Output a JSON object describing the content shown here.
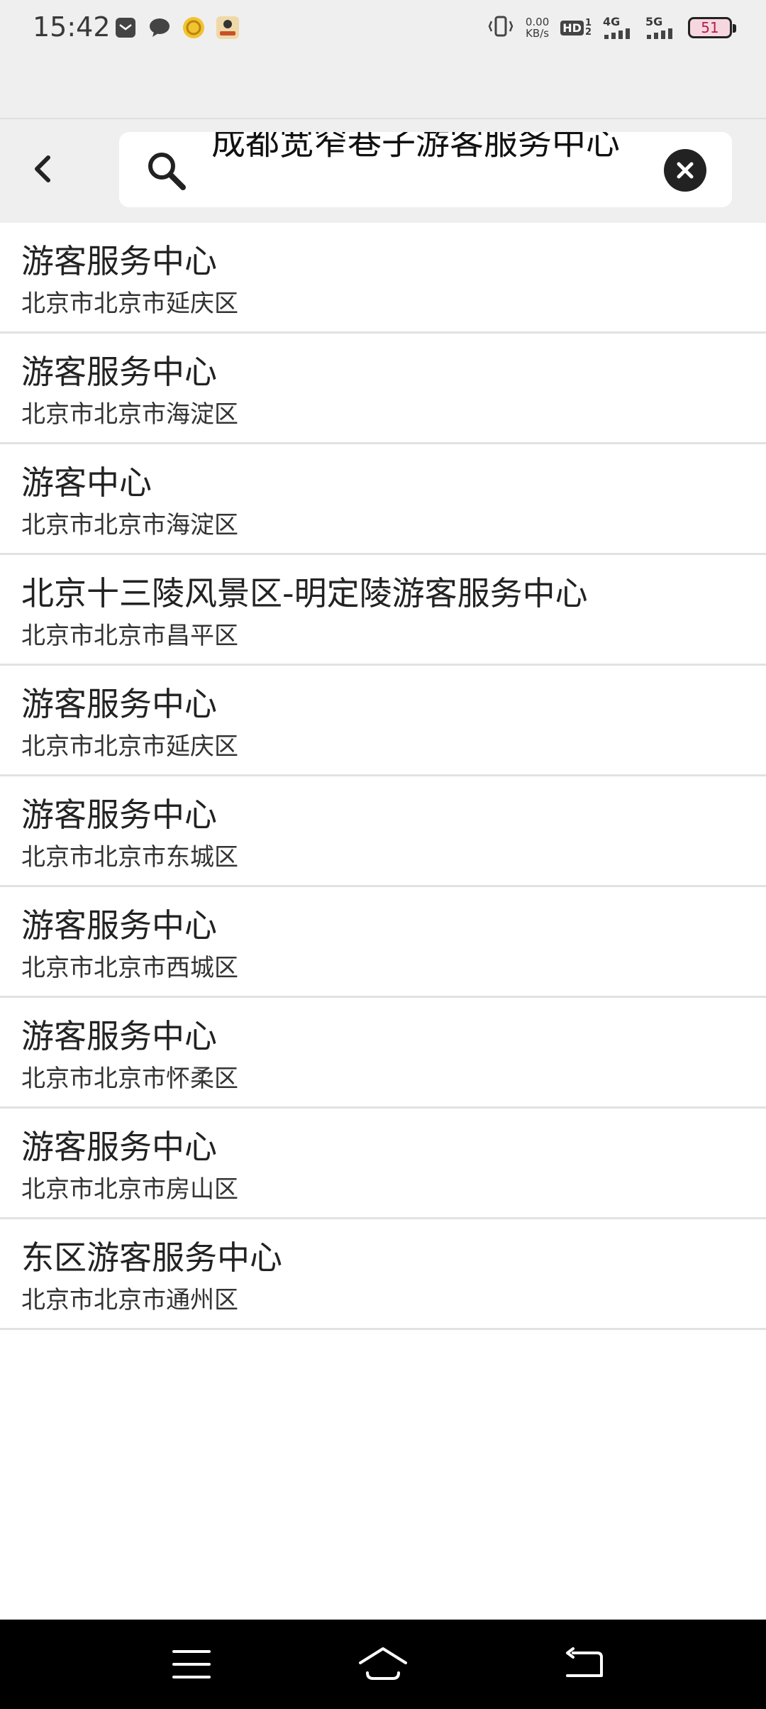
{
  "status_bar": {
    "time": "15:42",
    "net_speed_value": "0.00",
    "net_speed_unit": "KB/s",
    "hd_label": "HD",
    "sim1": "1",
    "sim2": "2",
    "net_4g": "4G",
    "net_5g": "5G",
    "battery": "51"
  },
  "search": {
    "query": "成都宽窄巷子游客服务中心",
    "back_icon": "chevron-left-icon",
    "search_icon": "magnifier-icon",
    "clear_icon": "close-circle-icon"
  },
  "results": [
    {
      "title": "游客服务中心",
      "subtitle": "北京市北京市延庆区"
    },
    {
      "title": "游客服务中心",
      "subtitle": "北京市北京市海淀区"
    },
    {
      "title": "游客中心",
      "subtitle": "北京市北京市海淀区"
    },
    {
      "title": "北京十三陵风景区-明定陵游客服务中心",
      "subtitle": "北京市北京市昌平区"
    },
    {
      "title": "游客服务中心",
      "subtitle": "北京市北京市延庆区"
    },
    {
      "title": "游客服务中心",
      "subtitle": "北京市北京市东城区"
    },
    {
      "title": "游客服务中心",
      "subtitle": "北京市北京市西城区"
    },
    {
      "title": "游客服务中心",
      "subtitle": "北京市北京市怀柔区"
    },
    {
      "title": "游客服务中心",
      "subtitle": "北京市北京市房山区"
    },
    {
      "title": "东区游客服务中心",
      "subtitle": "北京市北京市通州区"
    }
  ],
  "nav": {
    "menu_icon": "menu-icon",
    "home_icon": "home-icon",
    "back_icon": "back-icon"
  },
  "colors": {
    "header_bg": "#efeff0",
    "nav_bg": "#000000",
    "divider": "#e2e2e2",
    "text": "#222222"
  }
}
